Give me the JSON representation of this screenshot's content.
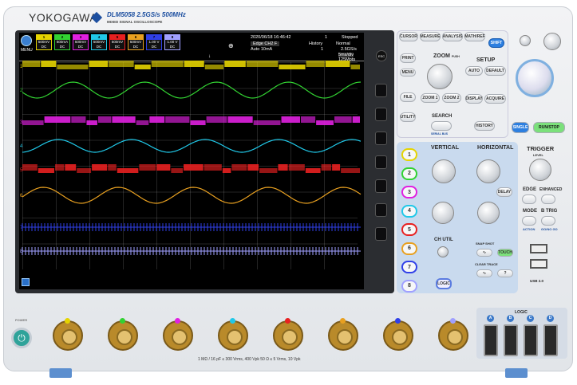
{
  "brand": "YOKOGAWA",
  "model": "DLM5058",
  "spec": "2.5GS/s 500MHz",
  "subtitle": "MIXED SIGNAL OSCILLOSCOPE",
  "screen": {
    "menu_label": "MENU",
    "date": "2020/06/18 16:46:42",
    "acq_count": "1",
    "state": "Stopped",
    "trig_info": "Edge CH2 F",
    "trig_level": "Auto 10mA",
    "history": "History",
    "history_val": "1",
    "normal": "Normal",
    "sample_rate": "2.5GS/s",
    "timebase": "5ms/div",
    "record": "125Mpts",
    "channels": [
      {
        "num": "1",
        "scale": "500mV",
        "extra": "DC",
        "color": "#e5d400"
      },
      {
        "num": "2",
        "scale": "500mA",
        "extra": "DC",
        "color": "#32d232"
      },
      {
        "num": "3",
        "scale": "500mV",
        "extra": "DC",
        "color": "#e020e0"
      },
      {
        "num": "4",
        "scale": "500mV",
        "extra": "DC",
        "color": "#20c8e8"
      },
      {
        "num": "5",
        "scale": "500mV",
        "extra": "DC",
        "color": "#e82020"
      },
      {
        "num": "6",
        "scale": "500mV",
        "extra": "DC",
        "color": "#e8a020"
      },
      {
        "num": "7",
        "scale": "1.00 V",
        "extra": "DC",
        "color": "#3040e8"
      },
      {
        "num": "8",
        "scale": "1.00 V",
        "extra": "DC",
        "color": "#a0a0ff"
      }
    ]
  },
  "top_buttons": {
    "cursor": "CURSOR",
    "measure": "MEASURE",
    "analysis": "ANALYSIS",
    "mathref": "MATH/REF",
    "shift": "SHIFT",
    "print": "PRINT",
    "menu": "MENU",
    "file": "FILE",
    "utility": "UTILITY",
    "zoom": "ZOOM",
    "push": "PUSH",
    "zoom1": "ZOOM 1",
    "zoom2": "ZOOM 2",
    "search": "SEARCH",
    "serial_bus": "SERIAL BUS",
    "setup": "SETUP",
    "auto": "AUTO",
    "default": "DEFAULT",
    "display": "DISPLAY",
    "acquire": "ACQUIRE",
    "history": "HISTORY",
    "single": "SINGLE",
    "run_stop": "RUN/STOP"
  },
  "vertical": {
    "title": "VERTICAL",
    "ch_util": "CH UTIL",
    "logic": "LOGIC",
    "snap_shot": "SNAP SHOT",
    "touch": "TOUCH",
    "clear_trace": "CLEAR TRACE",
    "help": "?",
    "channel_buttons": [
      "1",
      "2",
      "3",
      "4",
      "5",
      "6",
      "7",
      "8"
    ]
  },
  "horizontal": {
    "title": "HORIZONTAL",
    "delay": "DELAY"
  },
  "trigger": {
    "title": "TRIGGER",
    "level": "LEVEL",
    "edge": "EDGE",
    "enhanced": "ENHANCED",
    "mode": "MODE",
    "btrig": "B TRIG",
    "action": "ACTION",
    "go_nogo": "GO/NO GO",
    "usb": "USB 2.0"
  },
  "front": {
    "power": "POWER",
    "spec_line": "1 MΩ / 16 pF ≤ 300 Vrms, 400 Vpk    50 Ω ≤ 5 Vrms, 10 Vpk",
    "logic_label": "LOGIC",
    "logic_ports": [
      "A",
      "B",
      "C",
      "D"
    ],
    "bnc_colors": [
      "#e5d400",
      "#32d232",
      "#e020e0",
      "#20c8e8",
      "#e82020",
      "#e8a020",
      "#3040e8",
      "#a0a0ff"
    ]
  }
}
